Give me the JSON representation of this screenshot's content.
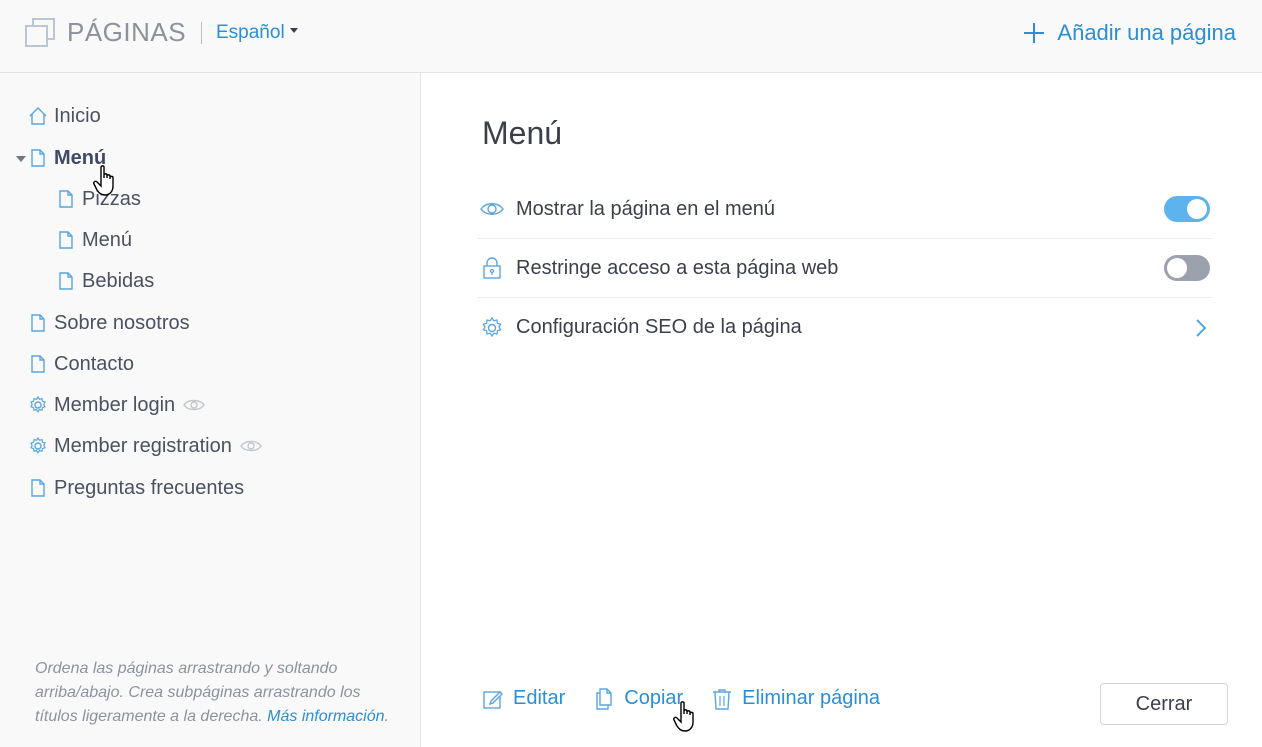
{
  "header": {
    "title": "PÁGINAS",
    "language": "Español",
    "add_page_label": "Añadir una página"
  },
  "sidebar": {
    "items": [
      {
        "label": "Inicio",
        "icon": "home-icon",
        "indent": 0
      },
      {
        "label": "Menú",
        "icon": "page-icon",
        "indent": 0,
        "active": true,
        "expanded": true
      },
      {
        "label": "Pizzas",
        "icon": "page-icon",
        "indent": 1
      },
      {
        "label": "Menú",
        "icon": "page-icon",
        "indent": 1
      },
      {
        "label": "Bebidas",
        "icon": "page-icon",
        "indent": 1
      },
      {
        "label": "Sobre nosotros",
        "icon": "page-icon",
        "indent": 0
      },
      {
        "label": "Contacto",
        "icon": "page-icon",
        "indent": 0
      },
      {
        "label": "Member login",
        "icon": "gear-icon",
        "indent": 0,
        "hidden": true
      },
      {
        "label": "Member registration",
        "icon": "gear-icon",
        "indent": 0,
        "hidden": true
      },
      {
        "label": "Preguntas frecuentes",
        "icon": "page-icon",
        "indent": 0
      }
    ],
    "help_text": "Ordena las páginas arrastrando y soltando arriba/abajo. Crea subpáginas arrastrando los títulos ligeramente a la derecha.",
    "help_link": "Más información"
  },
  "main": {
    "page_title": "Menú",
    "settings": [
      {
        "label": "Mostrar la página en el menú",
        "icon": "eye-icon",
        "control": "toggle",
        "on": true
      },
      {
        "label": "Restringe acceso a esta página web",
        "icon": "lock-icon",
        "control": "toggle",
        "on": false
      },
      {
        "label": "Configuración SEO de la página",
        "icon": "gear-icon",
        "control": "chevron"
      }
    ],
    "actions": {
      "edit_label": "Editar",
      "copy_label": "Copiar",
      "delete_label": "Eliminar página"
    },
    "close_label": "Cerrar"
  },
  "colors": {
    "accent": "#2a8fd6",
    "toggle_on": "#5db3ee",
    "toggle_off": "#9ba2ad",
    "sidebar_bg": "#f9f9f9"
  }
}
